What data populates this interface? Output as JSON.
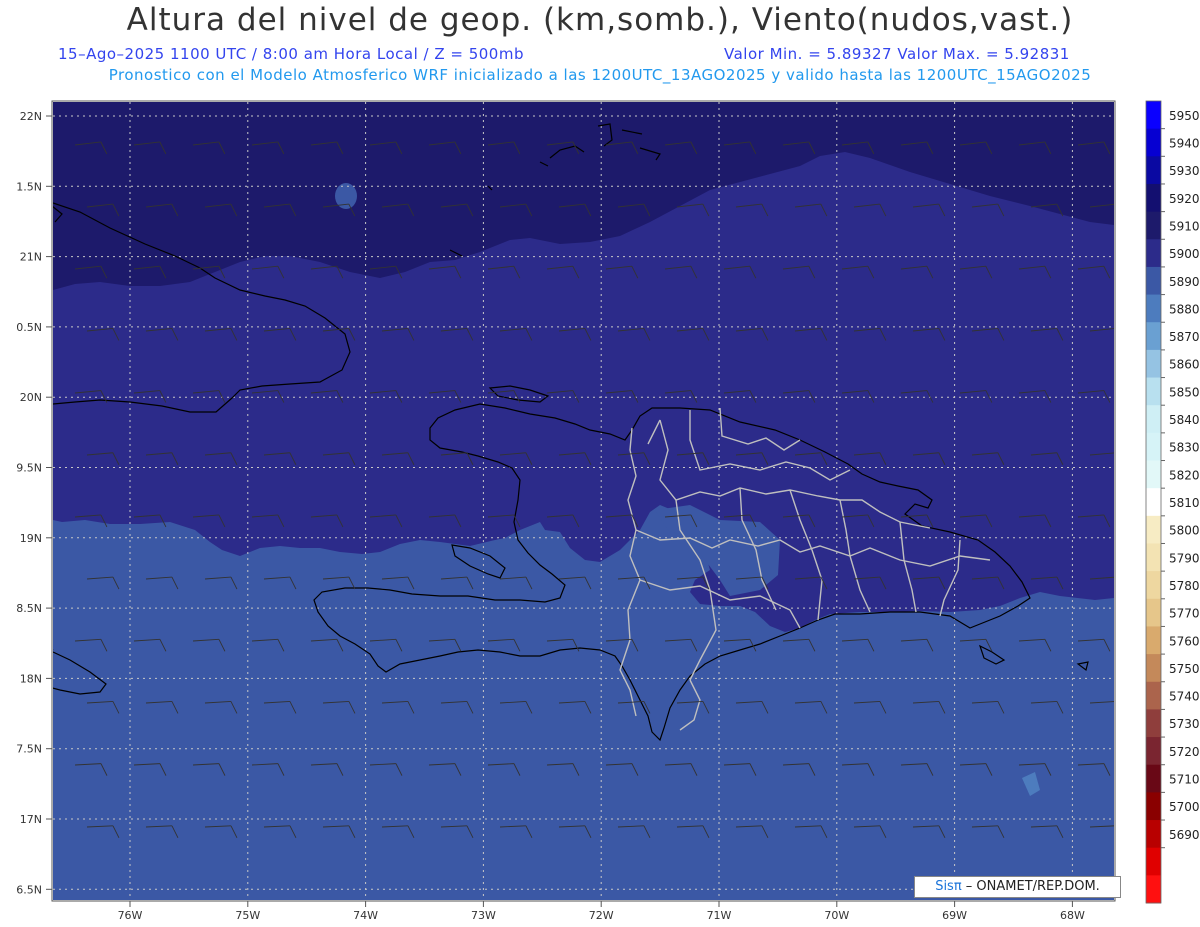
{
  "header": {
    "title": "Altura del nivel de geop. (km,somb.), Viento(nudos,vast.)",
    "subtitle_left": "15–Ago–2025  1100 UTC / 8:00 am Hora Local / Z = 500mb",
    "subtitle_right": "Valor Min. = 5.89327  Valor Max. = 5.92831",
    "subtitle_model": "Pronostico con el Modelo Atmosferico WRF inicializado a las 1200UTC_13AGO2025 y valido hasta las  1200UTC_15AGO2025"
  },
  "map": {
    "lat_labels": [
      "22N",
      "1.5N",
      "21N",
      "0.5N",
      "20N",
      "9.5N",
      "19N",
      "8.5N",
      "18N",
      "7.5N",
      "17N",
      "6.5N"
    ],
    "lon_labels": [
      "76W",
      "75W",
      "74W",
      "73W",
      "72W",
      "71W",
      "70W",
      "69W",
      "68W"
    ],
    "lon_range": [
      -76.6,
      -67.6
    ],
    "lat_range": [
      16.4,
      22.1
    ],
    "field_colors": {
      "fill_5920": "#1d1a6b",
      "fill_5910": "#2c2b8a",
      "fill_5900": "#3b58a5"
    },
    "coastline_color": "#000000",
    "province_border_color": "#bfbfbf",
    "grid_color": "#c8c8c8",
    "wind_barb_color": "#333333"
  },
  "colorbar": {
    "levels": [
      "5950",
      "5940",
      "5930",
      "5920",
      "5910",
      "5900",
      "5890",
      "5880",
      "5870",
      "5860",
      "5850",
      "5840",
      "5830",
      "5820",
      "5810",
      "5800",
      "5790",
      "5780",
      "5770",
      "5760",
      "5750",
      "5740",
      "5730",
      "5720",
      "5710",
      "5700",
      "5690"
    ],
    "colors": [
      "#0a00ff",
      "#0600d2",
      "#0a09a2",
      "#130f70",
      "#1d1a6b",
      "#2c2b8a",
      "#3b58a5",
      "#4d7cbe",
      "#6aa0d2",
      "#95c3e3",
      "#b8e0ef",
      "#cfeff5",
      "#d6f3f7",
      "#e2f8f8",
      "#ffffff",
      "#f7ecc4",
      "#f3e3b3",
      "#eed7a0",
      "#e6c68a",
      "#d9aa6d",
      "#c4895a",
      "#ab644c",
      "#8f3e3c",
      "#7a2530",
      "#690816",
      "#8a0000",
      "#b80000",
      "#e00000",
      "#ff1010"
    ]
  },
  "credit": {
    "brand": "Sisπ",
    "org": " – ONAMET/REP.DOM."
  }
}
